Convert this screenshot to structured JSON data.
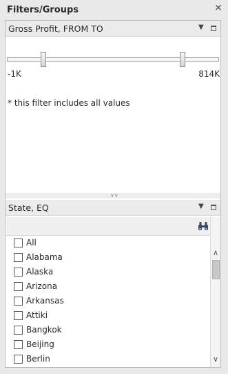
{
  "panel": {
    "title": "Filters/Groups",
    "close_icon": "close-icon"
  },
  "gross_profit_filter": {
    "title": "Gross Profit, FROM TO",
    "min_label": "-1K",
    "max_label": "814K",
    "range_from_fraction": 0.0,
    "range_to_fraction": 1.0,
    "note": "* this filter includes all values",
    "icons": [
      "chevron-down-icon",
      "maximize-icon"
    ]
  },
  "state_filter": {
    "title": "State, EQ",
    "search_icon": "binoculars-icon",
    "items": [
      {
        "label": "All",
        "checked": false
      },
      {
        "label": "Alabama",
        "checked": false
      },
      {
        "label": "Alaska",
        "checked": false
      },
      {
        "label": "Arizona",
        "checked": false
      },
      {
        "label": "Arkansas",
        "checked": false
      },
      {
        "label": "Attiki",
        "checked": false
      },
      {
        "label": "Bangkok",
        "checked": false
      },
      {
        "label": "Beijing",
        "checked": false
      },
      {
        "label": "Berlin",
        "checked": false
      }
    ]
  },
  "colors": {
    "background": "#e8e8e8",
    "panel_bg": "#ffffff",
    "header_bg": "#ebebeb"
  }
}
